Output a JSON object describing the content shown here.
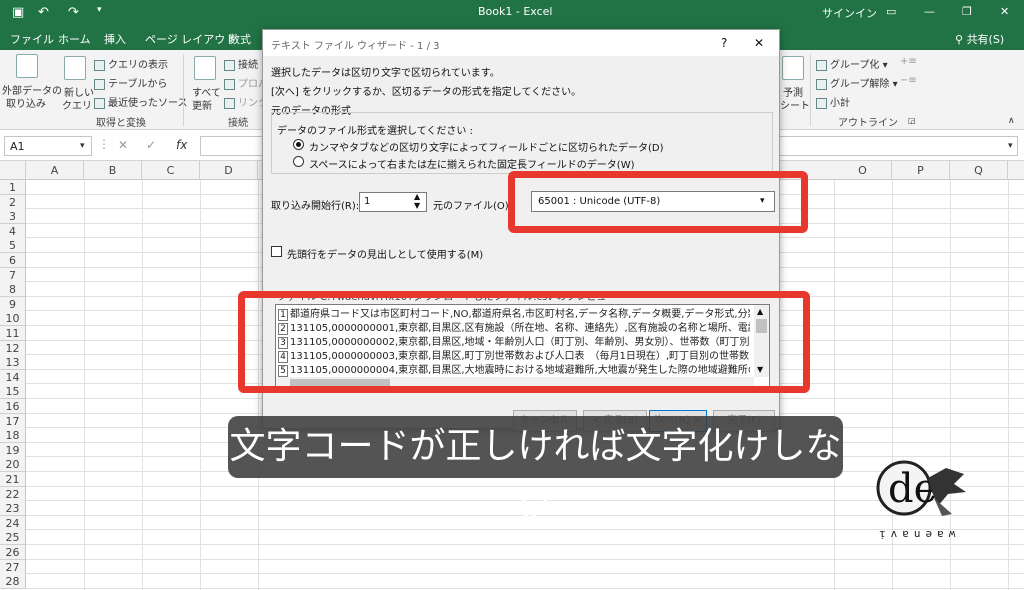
{
  "titlebar": {
    "title": "Book1 - Excel",
    "signin": "サインイン"
  },
  "ribbon_tabs": [
    "ファイル",
    "ホーム",
    "挿入",
    "ページ レイアウト",
    "数式"
  ],
  "share_label": "共有(S)",
  "ribbon": {
    "external_data": [
      "外部データの",
      "取り込み"
    ],
    "new_query": [
      "新しい",
      "クエリ"
    ],
    "query_items": [
      "クエリの表示",
      "テーブルから",
      "最近使ったソース"
    ],
    "group_get": "取得と変換",
    "refresh_all": [
      "すべて",
      "更新"
    ],
    "connection_items": [
      "接続",
      "プロパ",
      "リンクの"
    ],
    "group_connections": "接続",
    "forecast": [
      "予測",
      "シート"
    ],
    "outline_items": [
      "グループ化",
      "グループ解除",
      "小計"
    ],
    "group_outline": "アウトライン"
  },
  "formula": {
    "namebox": "A1",
    "fx": "fx"
  },
  "columns": [
    "A",
    "B",
    "C",
    "D",
    "O",
    "P",
    "Q"
  ],
  "rows": [
    "1",
    "2",
    "3",
    "4",
    "5",
    "6",
    "7",
    "8",
    "9",
    "10",
    "11",
    "12",
    "13",
    "14",
    "15",
    "16",
    "17",
    "18",
    "19",
    "20",
    "21",
    "22",
    "23",
    "24",
    "25",
    "26",
    "27",
    "28"
  ],
  "dialog": {
    "title": "テキスト ファイル ウィザード - 1 / 3",
    "help": "?",
    "close": "✕",
    "line1": "選択したデータは区切り文字で区切られています。",
    "line2": "[次へ] をクリックするか、区切るデータの形式を指定してください。",
    "section": "元のデータの形式",
    "select_prompt": "データのファイル形式を選択してください :",
    "radio1": "カンマやタブなどの区切り文字によってフィールドごとに区切られたデータ(D)",
    "radio2": "スペースによって右または左に揃えられた固定長フィールドのデータ(W)",
    "start_row_label": "取り込み開始行(R):",
    "start_row_value": "1",
    "origin_label": "元のファイル(O):",
    "origin_value": "65001 : Unicode (UTF-8)",
    "header_check": "先頭行をデータの見出しとして使用する(M)",
    "preview_label": "ファイル C:¥waenavi¥fx10¥ダウンロードしたファイル.csv のプレビュー",
    "preview_lines": [
      "都道府県コード又は市区町村コード,NO,都道府県名,市区町村名,データ名称,データ概要,データ形式,分類,更",
      "131105,0000000001,東京都,目黒区,区有施設（所在地、名称、連絡先）,区有施設の名称と場所、電話番号、",
      "131105,0000000002,東京都,目黒区,地域・年齢別人口（町丁別、年齢別、男女別）、世帯数（町丁別）,町丁",
      "131105,0000000003,東京都,目黒区,町丁別世帯数および人口表　（毎月1日現在）,町丁目別の世帯数と人口,",
      "131105,0000000004,東京都,目黒区,大地震時における地域避難所,大地震が発生した際の地域避難所の名称と"
    ],
    "preview_nums": [
      "1",
      "2",
      "3",
      "4",
      "5"
    ],
    "buttons": [
      "キャンセル",
      "< 戻る(B)",
      "次へ(N) >",
      "完了(F)"
    ]
  },
  "caption": "文字コードが正しければ文字化けしない",
  "logo_text": "waenavi",
  "accent": "#217346",
  "highlight": "#e8382e"
}
